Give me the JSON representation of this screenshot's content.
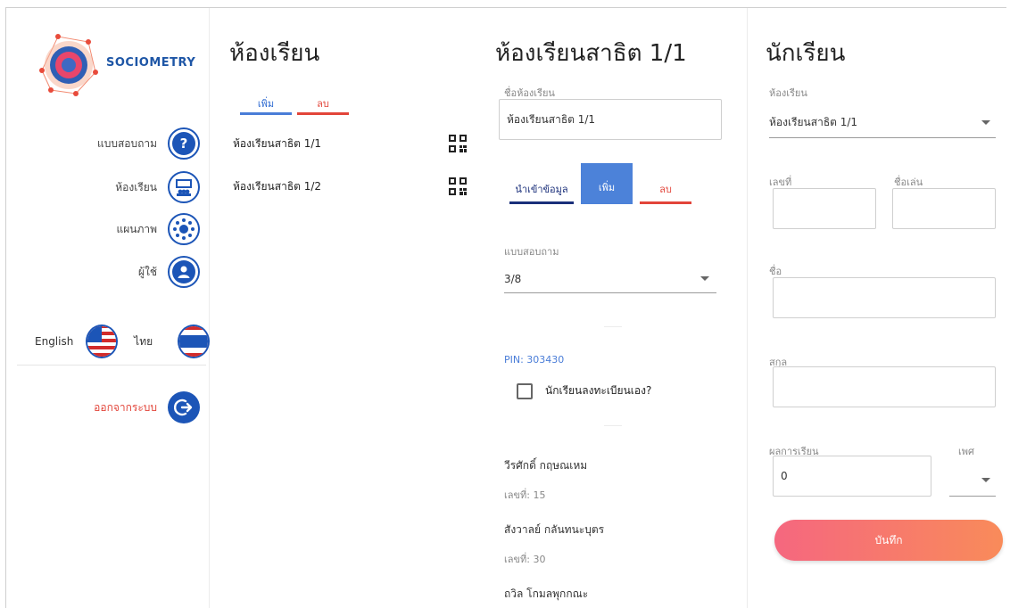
{
  "sidebar": {
    "logo_text": "SOCIOMETRY",
    "items": [
      {
        "label": "แบบสอบถาม",
        "icon": "question-icon"
      },
      {
        "label": "ห้องเรียน",
        "icon": "classroom-icon"
      },
      {
        "label": "แผนภาพ",
        "icon": "network-icon"
      },
      {
        "label": "ผู้ใช้",
        "icon": "user-icon"
      }
    ],
    "lang_english": "English",
    "lang_thai": "ไทย",
    "logout_label": "ออกจากระบบ"
  },
  "classrooms": {
    "title": "ห้องเรียน",
    "add_label": "เพิ่ม",
    "delete_label": "ลบ",
    "rooms": [
      {
        "name": "ห้องเรียนสาธิต 1/1"
      },
      {
        "name": "ห้องเรียนสาธิต 1/2"
      }
    ]
  },
  "room_detail": {
    "title": "ห้องเรียนสาธิต 1/1",
    "name_label": "ชื่อห้องเรียน",
    "name_value": "ห้องเรียนสาธิต 1/1",
    "import_label": "นำเข้าข้อมูล",
    "add_label": "เพิ่ม",
    "delete_label": "ลบ",
    "survey_label": "แบบสอบถาม",
    "survey_value": "3/8",
    "pin": "PIN: 303430",
    "self_register_label": "นักเรียนลงทะเบียนเอง?",
    "students": [
      {
        "name": "วีรศักดิ์ กฤษณเหม",
        "number": "เลขที่: 15"
      },
      {
        "name": "สังวาลย์ กลันทนะบุตร",
        "number": "เลขที่: 30"
      },
      {
        "name": "ถวิล โกมลพุกกณะ",
        "number": ""
      }
    ]
  },
  "student_form": {
    "title": "นักเรียน",
    "classroom_label": "ห้องเรียน",
    "classroom_value": "ห้องเรียนสาธิต 1/1",
    "number_label": "เลขที่",
    "nickname_label": "ชื่อเล่น",
    "first_name_label": "ชื่อ",
    "last_name_label": "สกุล",
    "grade_label": "ผลการเรียน",
    "grade_value": "0",
    "gender_label": "เพศ",
    "save_label": "บันทึก"
  },
  "colors": {
    "primary_blue": "#1c55b7",
    "accent_blue": "#4c82d9",
    "danger_red": "#e2453a",
    "gradient_start": "#f5677f",
    "gradient_end": "#f98b5a"
  }
}
